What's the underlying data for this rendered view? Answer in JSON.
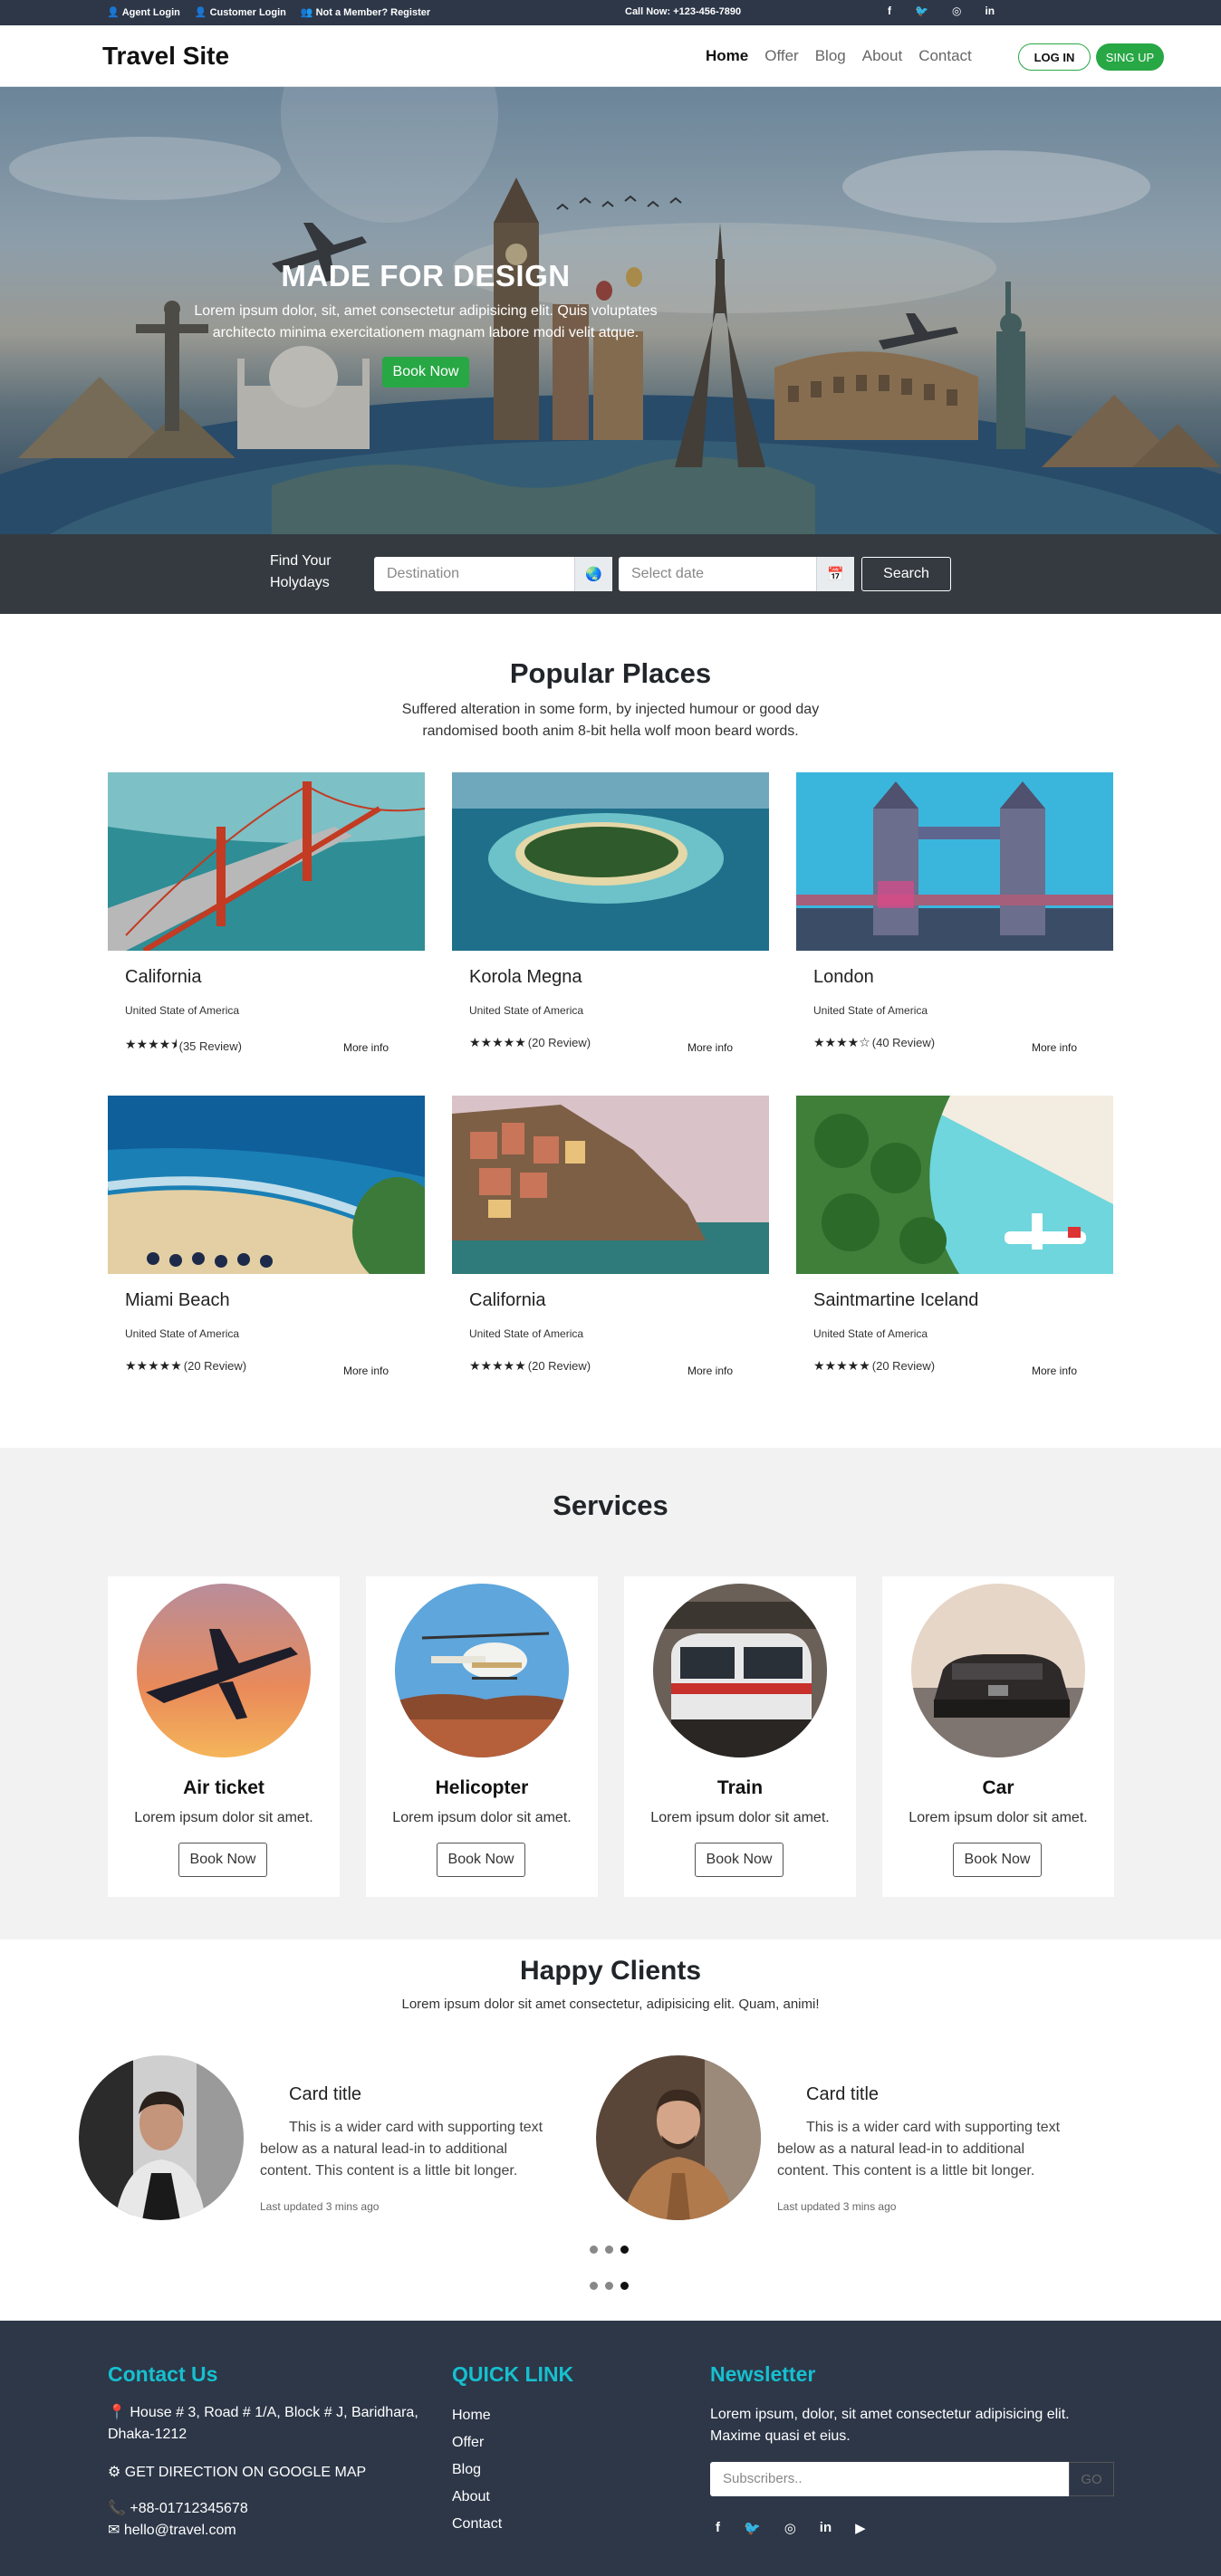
{
  "topbar": {
    "agent_login": "Agent Login",
    "customer_login": "Customer Login",
    "register": "Not a Member? Register",
    "call": "Call Now: +123-456-7890",
    "social": [
      "f",
      "t",
      "ig",
      "in"
    ]
  },
  "nav": {
    "brand": "Travel Site",
    "items": [
      "Home",
      "Offer",
      "Blog",
      "About",
      "Contact"
    ],
    "login": "LOG IN",
    "signup": "SING UP"
  },
  "hero": {
    "title": "MADE FOR DESIGN",
    "description": "Lorem ipsum dolor, sit, amet consectetur adipisicing elit. Quis voluptates architecto minima exercitationem magnam labore modi velit atque.",
    "button": "Book Now"
  },
  "search": {
    "label": "Find Your Holydays",
    "destination_placeholder": "Destination",
    "date_placeholder": "Select date",
    "button": "Search"
  },
  "popular": {
    "title": "Popular Places",
    "subtitle": "Suffered alteration in some form, by injected humour or good day randomised booth anim 8-bit hella wolf moon beard words.",
    "places": [
      {
        "name": "California",
        "country": "United State of America",
        "stars": "★★★★⯨",
        "reviews": "(35 Review)",
        "more": "More info"
      },
      {
        "name": "Korola Megna",
        "country": "United State of America",
        "stars": "★★★★★",
        "reviews": "(20 Review)",
        "more": "More info"
      },
      {
        "name": "London",
        "country": "United State of America",
        "stars": "★★★★☆",
        "reviews": "(40 Review)",
        "more": "More info"
      },
      {
        "name": "Miami Beach",
        "country": "United State of America",
        "stars": "★★★★★",
        "reviews": "(20 Review)",
        "more": "More info"
      },
      {
        "name": "California",
        "country": "United State of America",
        "stars": "★★★★★",
        "reviews": "(20 Review)",
        "more": "More info"
      },
      {
        "name": "Saintmartine Iceland",
        "country": "United State of America",
        "stars": "★★★★★",
        "reviews": "(20 Review)",
        "more": "More info"
      }
    ]
  },
  "services": {
    "title": "Services",
    "items": [
      {
        "title": "Air ticket",
        "desc": "Lorem ipsum dolor sit amet.",
        "button": "Book Now"
      },
      {
        "title": "Helicopter",
        "desc": "Lorem ipsum dolor sit amet.",
        "button": "Book Now"
      },
      {
        "title": "Train",
        "desc": "Lorem ipsum dolor sit amet.",
        "button": "Book Now"
      },
      {
        "title": "Car",
        "desc": "Lorem ipsum dolor sit amet.",
        "button": "Book Now"
      }
    ]
  },
  "clients": {
    "title": "Happy Clients",
    "subtitle": "Lorem ipsum dolor sit amet consectetur, adipisicing elit. Quam, animi!",
    "cards": [
      {
        "title": "Card title",
        "text": "This is a wider card with supporting text below as a natural lead-in to additional content. This content is a little bit longer.",
        "updated": "Last updated 3 mins ago"
      },
      {
        "title": "Card title",
        "text": "This is a wider card with supporting text below as a natural lead-in to additional content. This content is a little bit longer.",
        "updated": "Last updated 3 mins ago"
      }
    ]
  },
  "footer": {
    "contact_title": "Contact Us",
    "address": "House # 3, Road # 1/A, Block # J, Baridhara, Dhaka-1212",
    "direction": "GET DIRECTION ON GOOGLE MAP",
    "phone": "+88-01712345678",
    "email": "hello@travel.com",
    "quick_title": "QUICK LINK",
    "quick_links": [
      "Home",
      "Offer",
      "Blog",
      "About",
      "Contact"
    ],
    "news_title": "Newsletter",
    "news_text": "Lorem ipsum, dolor, sit amet consectetur adipisicing elit. Maxime quasi et eius.",
    "news_placeholder": "Subscribers..",
    "news_button": "GO",
    "social": [
      "f",
      "t",
      "ig",
      "in",
      "yt"
    ]
  }
}
